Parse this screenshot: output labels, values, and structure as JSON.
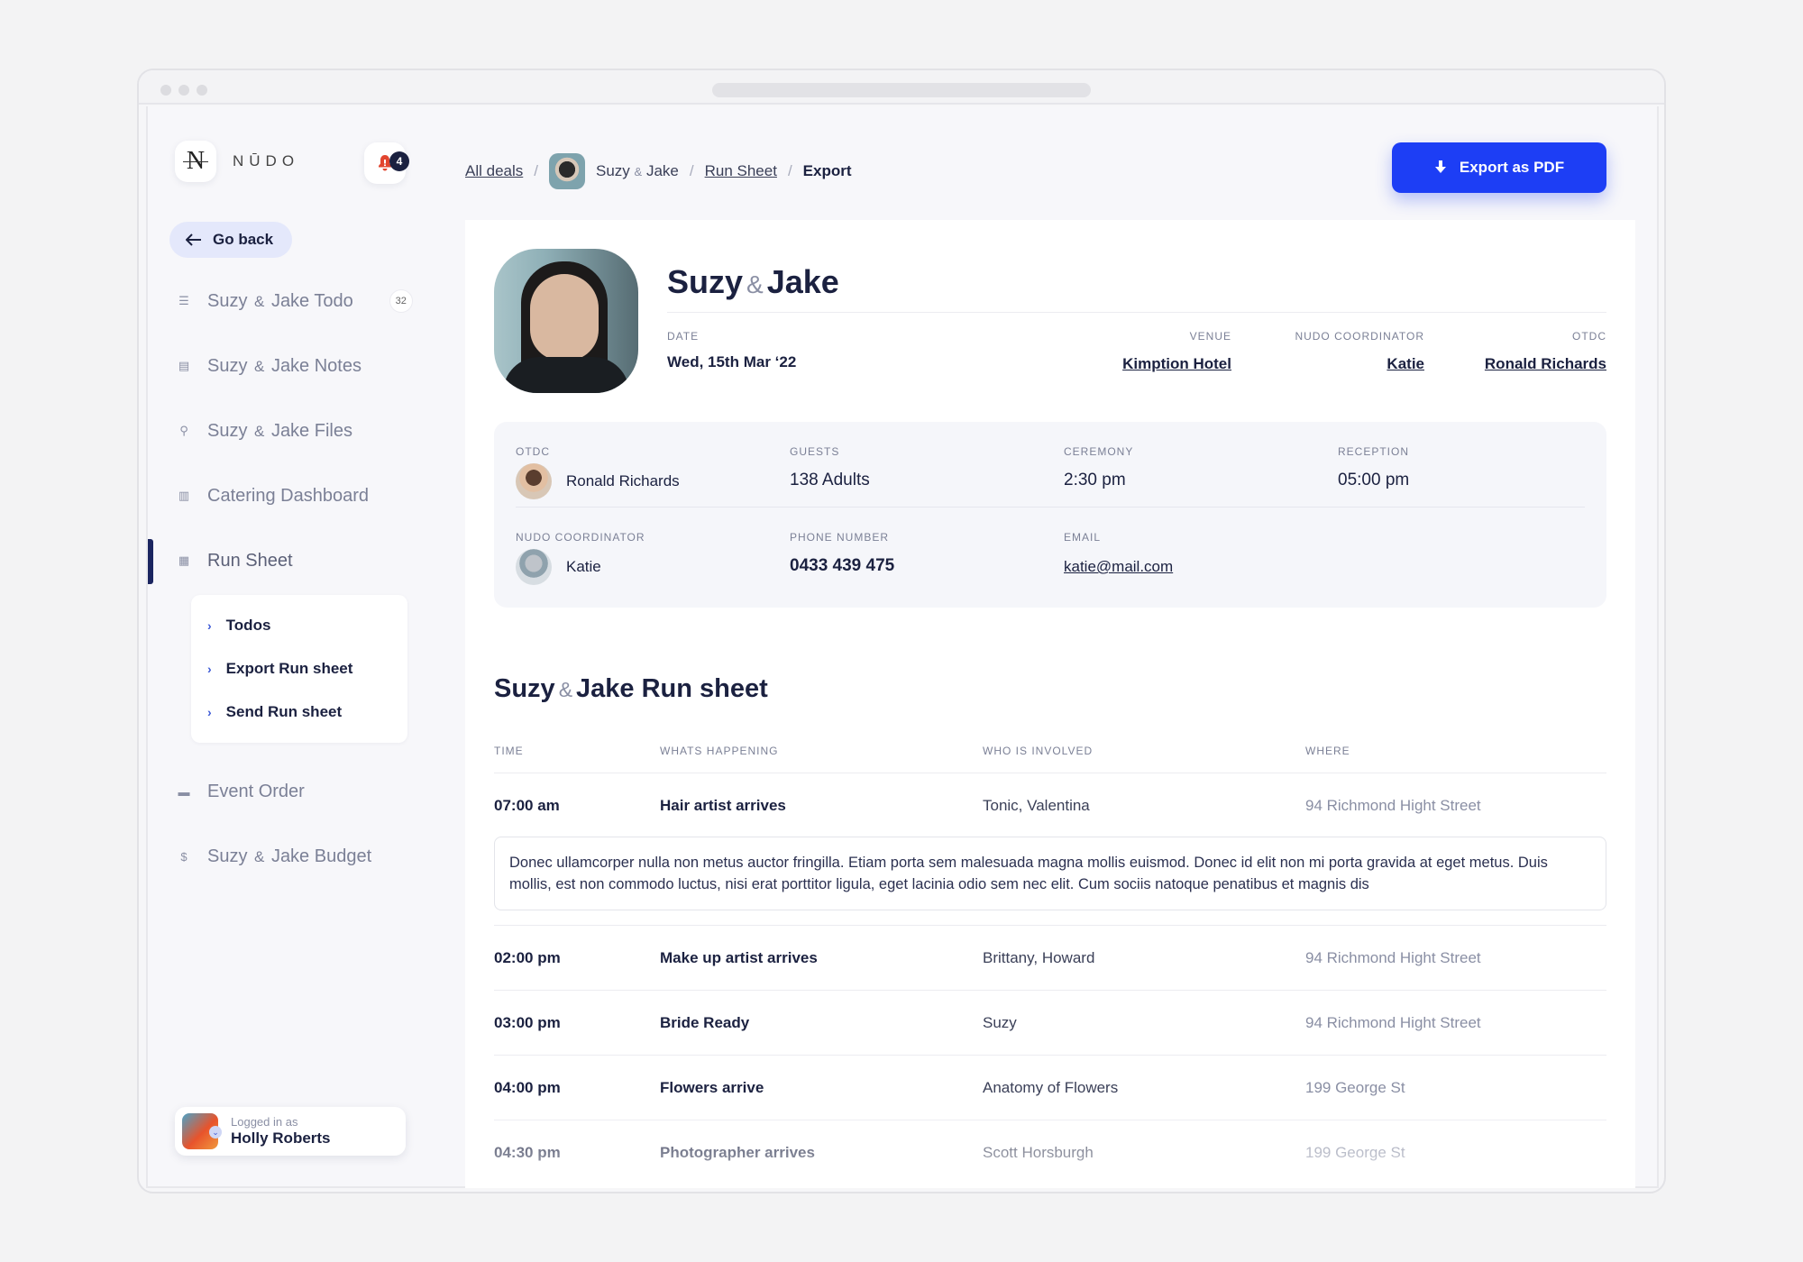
{
  "brand": {
    "name": "NŪDO",
    "mark": "N"
  },
  "notifications": {
    "count": "4"
  },
  "sidebar": {
    "go_back": "Go back",
    "items": [
      {
        "pre": "Suzy",
        "amp": "&",
        "post": "Jake Todo",
        "badge": "32",
        "icon": "list-icon"
      },
      {
        "pre": "Suzy",
        "amp": "&",
        "post": "Jake Notes",
        "icon": "note-icon"
      },
      {
        "pre": "Suzy",
        "amp": "&",
        "post": "Jake Files",
        "icon": "paperclip-icon"
      },
      {
        "label": "Catering Dashboard",
        "icon": "chart-icon"
      },
      {
        "label": "Run Sheet",
        "icon": "document-icon"
      },
      {
        "label": "Event Order",
        "icon": "stack-icon"
      },
      {
        "pre": "Suzy",
        "amp": "&",
        "post": "Jake Budget",
        "icon": "dollar-icon"
      }
    ],
    "subnav": [
      "Todos",
      "Export Run sheet",
      "Send Run sheet"
    ]
  },
  "user": {
    "label": "Logged in as",
    "name": "Holly Roberts"
  },
  "breadcrumb": {
    "all_deals": "All deals",
    "couple_pre": "Suzy",
    "couple_amp": "&",
    "couple_post": "Jake",
    "run_sheet": "Run Sheet",
    "current": "Export",
    "sep": "/"
  },
  "export_button": "Export as PDF",
  "hero": {
    "title_pre": "Suzy",
    "title_amp": "&",
    "title_post": "Jake",
    "date_label": "DATE",
    "date": "Wed, 15th Mar ‘22",
    "venue_label": "VENUE",
    "venue": "Kimption Hotel",
    "coordinator_label": "NUDO COORDINATOR",
    "coordinator": "Katie",
    "otdc_label": "OTDC",
    "otdc": "Ronald Richards"
  },
  "info": {
    "otdc_label": "OTDC",
    "otdc": "Ronald Richards",
    "guests_label": "GUESTS",
    "guests": "138 Adults",
    "ceremony_label": "CEREMONY",
    "ceremony": "2:30 pm",
    "reception_label": "RECEPTION",
    "reception": "05:00 pm",
    "coordinator_label": "NUDO COORDINATOR",
    "coordinator": "Katie",
    "phone_label": "PHONE NUMBER",
    "phone": "0433 439 475",
    "email_label": "EMAIL",
    "email": "katie@mail.com"
  },
  "runsheet": {
    "title_pre": "Suzy",
    "title_amp": "&",
    "title_post": "Jake Run sheet",
    "columns": [
      "TIME",
      "WHATS HAPPENING",
      "WHO IS INVOLVED",
      "WHERE"
    ],
    "rows": [
      [
        "07:00 am",
        "Hair artist arrives",
        "Tonic, Valentina",
        "94 Richmond Hight Street"
      ],
      [
        "02:00 pm",
        "Make up artist arrives",
        "Brittany, Howard",
        "94 Richmond Hight Street"
      ],
      [
        "03:00 pm",
        "Bride Ready",
        "Suzy",
        "94 Richmond Hight Street"
      ],
      [
        "04:00 pm",
        "Flowers arrive",
        "Anatomy of Flowers",
        "199 George St"
      ],
      [
        "04:30 pm",
        "Photographer arrives",
        "Scott Horsburgh",
        "199 George St"
      ]
    ],
    "note": "Donec ullamcorper nulla non metus auctor fringilla. Etiam porta sem malesuada magna mollis euismod. Donec id elit non mi porta gravida at eget metus. Duis mollis, est non commodo luctus, nisi erat porttitor ligula, eget lacinia odio sem nec elit. Cum sociis natoque penatibus et magnis dis"
  }
}
